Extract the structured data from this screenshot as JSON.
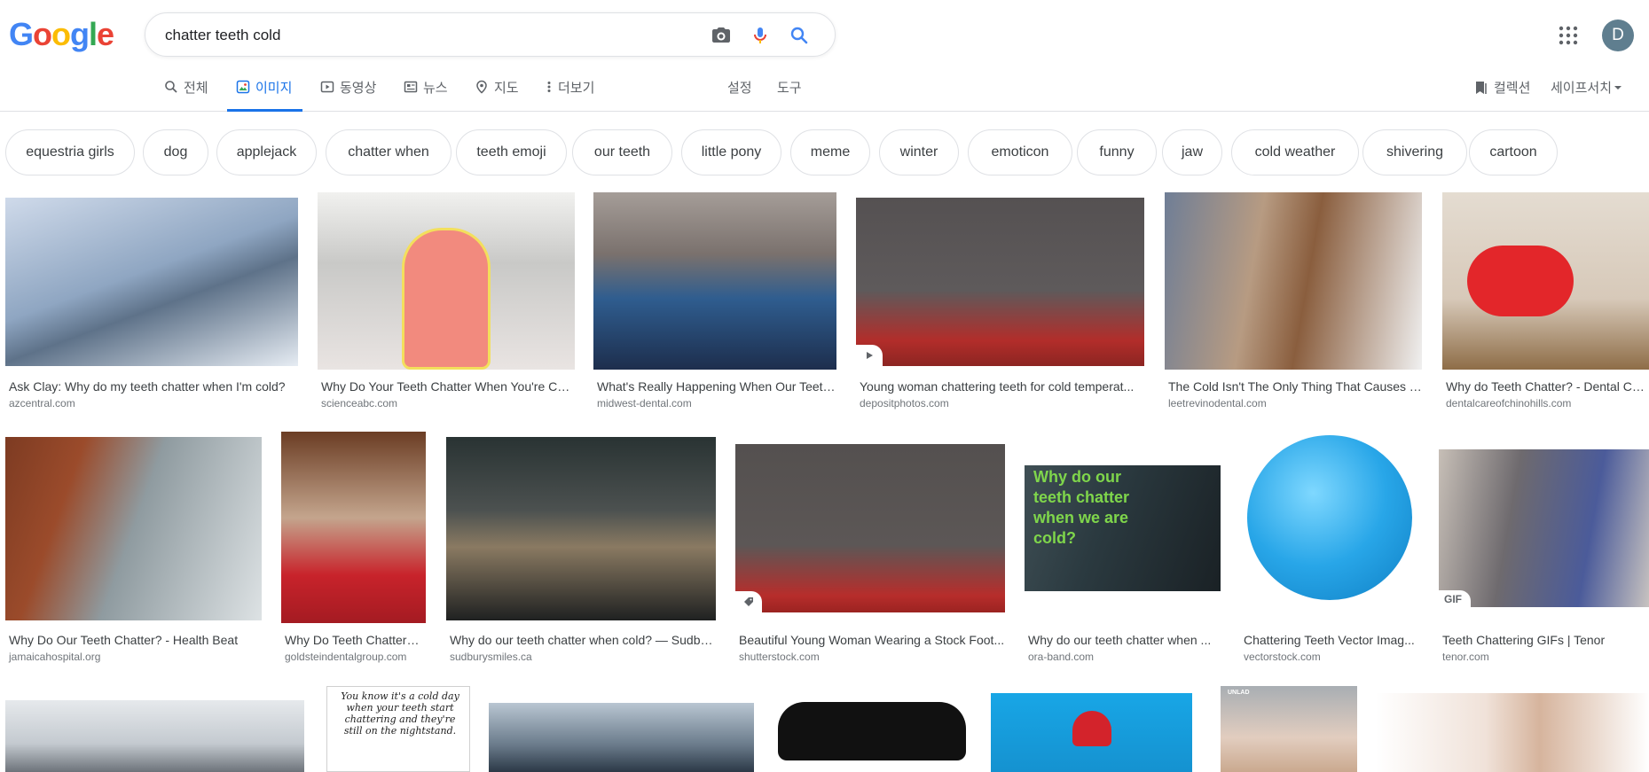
{
  "search": {
    "query": "chatter teeth cold"
  },
  "avatar": {
    "letter": "D"
  },
  "logo": {
    "letters": [
      "G",
      "o",
      "o",
      "g",
      "l",
      "e"
    ],
    "colors": [
      "#4285f4",
      "#ea4335",
      "#fbbc05",
      "#4285f4",
      "#34a853",
      "#ea4335"
    ]
  },
  "tabs": [
    {
      "label": "전체",
      "icon": "search-icon"
    },
    {
      "label": "이미지",
      "icon": "image-icon",
      "active": true
    },
    {
      "label": "동영상",
      "icon": "video-icon"
    },
    {
      "label": "뉴스",
      "icon": "news-icon"
    },
    {
      "label": "지도",
      "icon": "map-pin-icon"
    },
    {
      "label": "더보기",
      "icon": "more-icon"
    }
  ],
  "tools": {
    "settings": "설정",
    "tools": "도구"
  },
  "right_nav": {
    "collections": "컬렉션",
    "safesearch": "세이프서치"
  },
  "chips": [
    "equestria girls",
    "dog",
    "applejack",
    "chatter when",
    "teeth emoji",
    "our teeth",
    "little pony",
    "meme",
    "winter",
    "emoticon",
    "funny",
    "jaw",
    "cold weather",
    "shivering",
    "cartoon"
  ],
  "results": [
    {
      "caption": "Ask Clay: Why do my teeth chatter when I'm cold?",
      "source": "azcentral.com",
      "color": "#9bb0c8"
    },
    {
      "caption": "Why Do Your Teeth Chatter When You're Col...",
      "source": "scienceabc.com",
      "color": "#d8d8d6"
    },
    {
      "caption": "What's Really Happening When Our Teeth...",
      "source": "midwest-dental.com",
      "color": "#4a5f7a"
    },
    {
      "caption": "Young woman chattering teeth for cold temperat...",
      "source": "depositphotos.com",
      "color": "#5a5556"
    },
    {
      "caption": "The Cold Isn't The Only Thing That Causes T...",
      "source": "leetrevinodental.com",
      "color": "#8e8a86"
    },
    {
      "caption": "Why do Teeth Chatter? - Dental Ca...",
      "source": "dentalcareofchinohills.com",
      "color": "#c9b9a8"
    },
    {
      "caption": "Why Do Our Teeth Chatter? - Health Beat",
      "source": "jamaicahospital.org",
      "color": "#8d8f86"
    },
    {
      "caption": "Why Do Teeth Chatter? ...",
      "source": "goldsteindentalgroup.com",
      "color": "#7b4a3a"
    },
    {
      "caption": "Why do our teeth chatter when cold? — Sudbu...",
      "source": "sudburysmiles.ca",
      "color": "#4f5452"
    },
    {
      "caption": "Beautiful Young Woman Wearing a Stock Foot...",
      "source": "shutterstock.com",
      "color": "#55504f",
      "badge": "tag-icon"
    },
    {
      "caption": "Why do our teeth chatter when ...",
      "source": "ora-band.com",
      "color": "#2d3a3c",
      "overlay": "Why do our teeth chatter when we are cold?"
    },
    {
      "caption": "Chattering Teeth Vector Imag...",
      "source": "vectorstock.com",
      "color": "#ffffff"
    },
    {
      "caption": "Teeth Chattering GIFs | Tenor",
      "source": "tenor.com",
      "color": "#6d6a6e",
      "badge_text": "GIF"
    },
    {
      "color": "#d9dde2"
    },
    {
      "color": "#ffffff",
      "overlay": "You know it's a cold day when your teeth start chattering and they're still on the nightstand."
    },
    {
      "color": "#6b7c8c"
    },
    {
      "color": "#ffffff"
    },
    {
      "color": "#1a9ad6"
    },
    {
      "color": "#8a8f94",
      "overlay": "UNLAD"
    },
    {
      "color": "#f3ece7"
    }
  ]
}
